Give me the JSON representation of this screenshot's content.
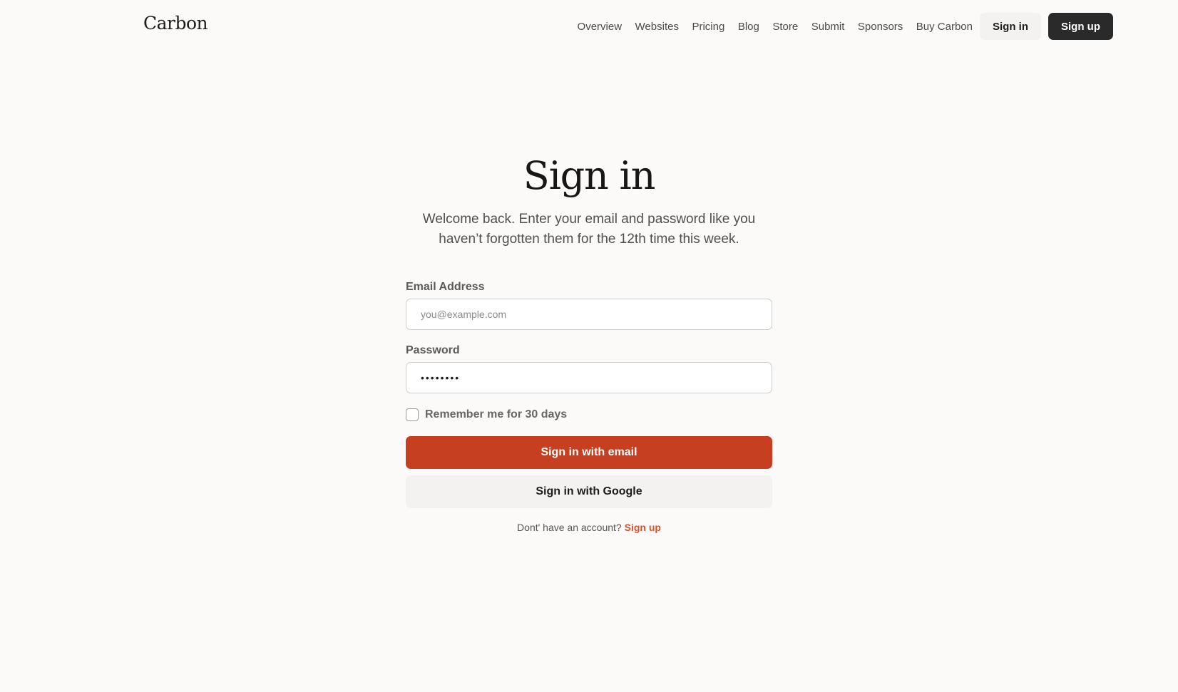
{
  "header": {
    "logo": "Carbon",
    "nav": [
      {
        "label": "Overview"
      },
      {
        "label": "Websites"
      },
      {
        "label": "Pricing"
      },
      {
        "label": "Blog"
      },
      {
        "label": "Store"
      },
      {
        "label": "Submit"
      },
      {
        "label": "Sponsors"
      },
      {
        "label": "Buy Carbon"
      }
    ],
    "sign_in_label": "Sign in",
    "sign_up_label": "Sign up"
  },
  "main": {
    "title": "Sign in",
    "subtitle": "Welcome back. Enter your email and password like you haven’t forgotten them for the 12th time this week.",
    "email": {
      "label": "Email Address",
      "placeholder": "you@example.com",
      "value": ""
    },
    "password": {
      "label": "Password",
      "value": "••••••••"
    },
    "remember": {
      "label": "Remember me for 30 days",
      "checked": false
    },
    "sign_in_email_label": "Sign in with email",
    "sign_in_google_label": "Sign in with Google",
    "no_account_text": "Dont' have an account?",
    "sign_up_link": "Sign up"
  },
  "colors": {
    "background": "#fbfaf8",
    "accent": "#c53f20",
    "link": "#d9532f",
    "dark_button": "#2a2a2a"
  }
}
